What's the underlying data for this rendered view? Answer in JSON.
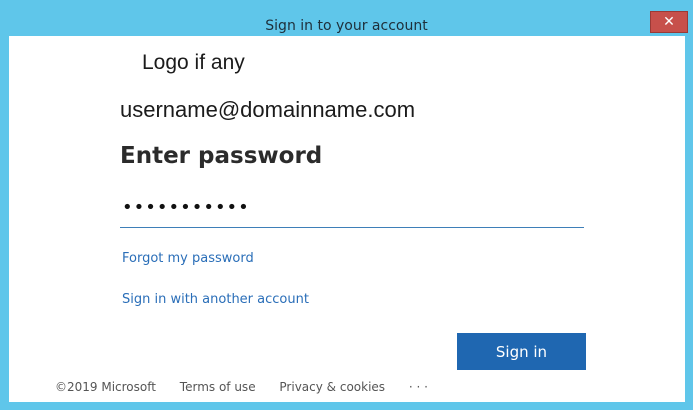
{
  "window": {
    "title": "Sign in to your account",
    "close_glyph": "✕",
    "titlebar_color": "#5fc6ea",
    "close_color": "#c7504b"
  },
  "signin": {
    "logo_text": "Logo if any",
    "account": "username@domainname.com",
    "heading": "Enter password",
    "password_value": "•••••••••••",
    "forgot_link": "Forgot my password",
    "another_link": "Sign in with another account",
    "signin_button": "Sign in",
    "button_color": "#1f67b1",
    "link_color": "#2a6eb8"
  },
  "footer": {
    "copyright": "©2019 Microsoft",
    "terms": "Terms of use",
    "privacy": "Privacy & cookies",
    "more": "· · ·"
  }
}
